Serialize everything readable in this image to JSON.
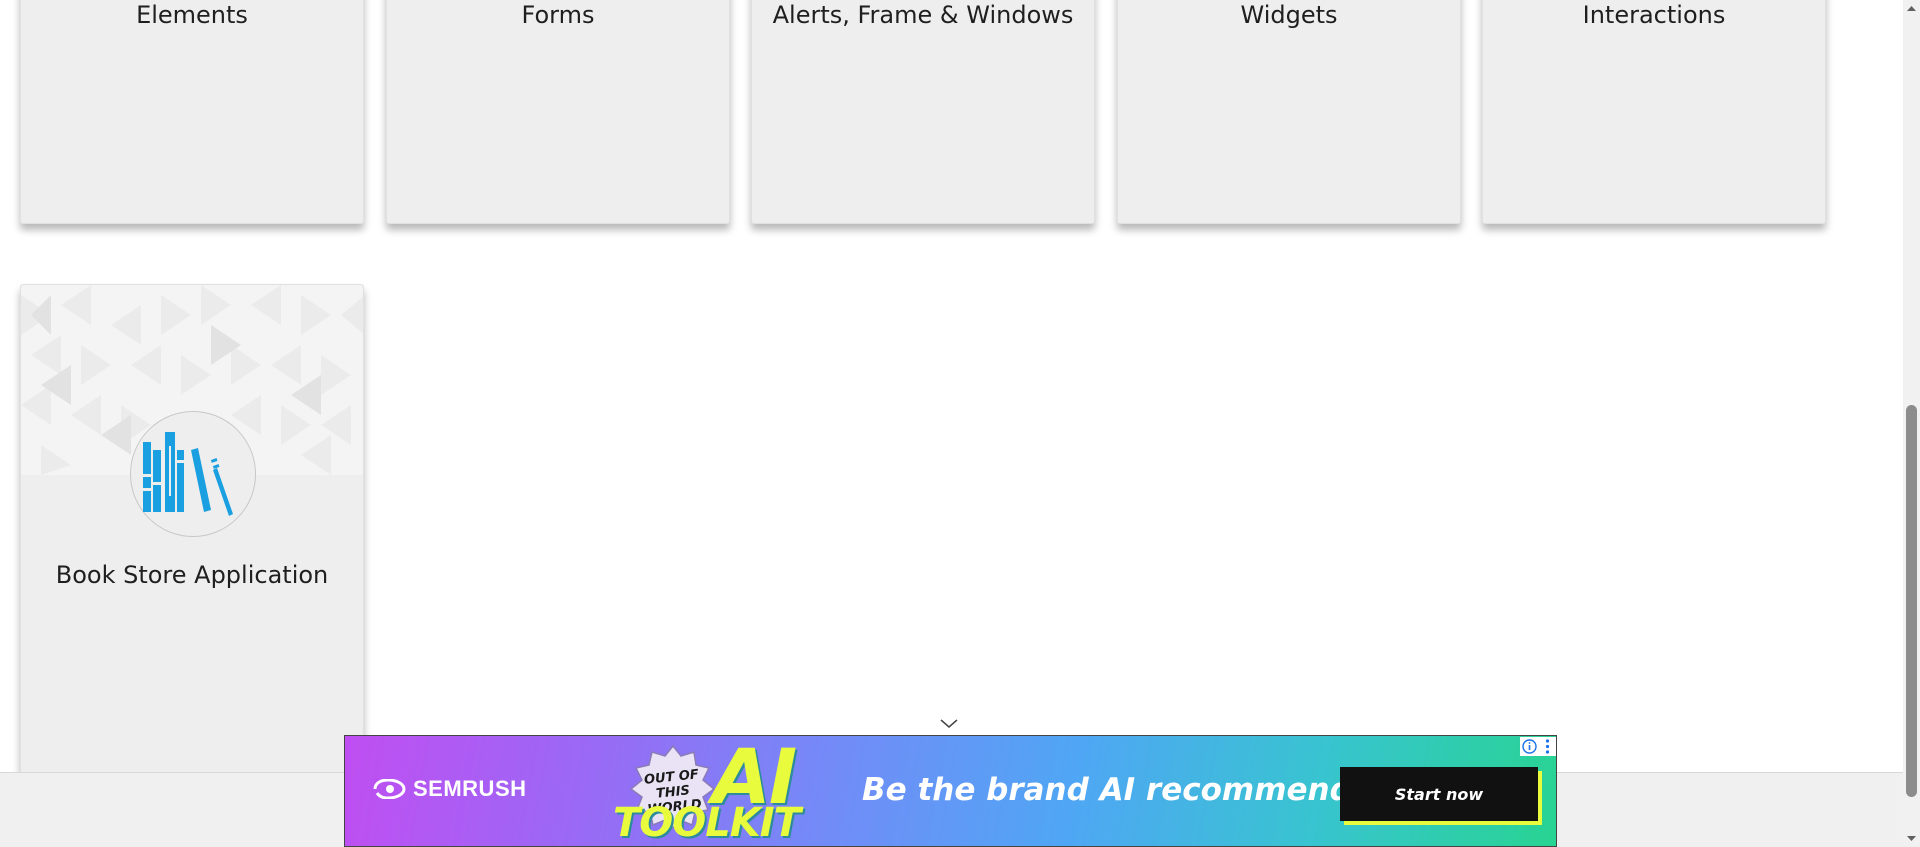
{
  "categories": [
    {
      "title": "Elements",
      "icon": "elements-icon"
    },
    {
      "title": "Forms",
      "icon": "forms-icon"
    },
    {
      "title": "Alerts, Frame & Windows",
      "icon": "alerts-icon"
    },
    {
      "title": "Widgets",
      "icon": "widgets-icon"
    },
    {
      "title": "Interactions",
      "icon": "interactions-icon"
    },
    {
      "title": "Book Store Application",
      "icon": "books-icon"
    }
  ],
  "ad": {
    "brand": "SEMRUSH",
    "badge_text": "OUT OF THIS WORLD",
    "ai_text": "AI",
    "toolkit_text": "TOOLKIT",
    "headline": "Be the brand AI recommends",
    "cta": "Start now",
    "info_icon": "info-icon",
    "menu_icon": "more-vertical-icon"
  },
  "colors": {
    "card_bg": "#eeeeee",
    "book_blue": "#1a9fe0",
    "cta_bg": "#111111",
    "accent_yellow": "#e9fb3d"
  }
}
